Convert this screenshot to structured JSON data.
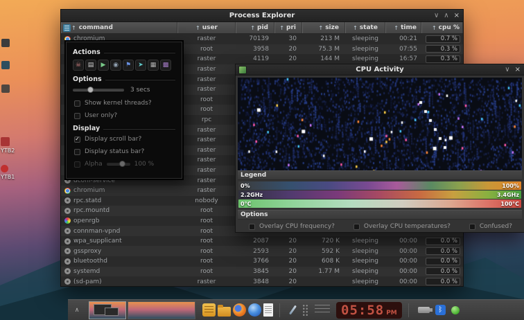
{
  "desktop": {
    "icons": [
      {
        "name": "shortcut-icon",
        "label": "YTB2"
      },
      {
        "name": "shortcut-icon",
        "label": "YTB1"
      }
    ]
  },
  "process_explorer": {
    "title": "Process Explorer",
    "window_controls": [
      "collapse-icon",
      "maximize-icon",
      "close-icon"
    ],
    "columns": [
      "command",
      "user",
      "pid",
      "pri",
      "size",
      "state",
      "time",
      "cpu %"
    ],
    "rows": [
      {
        "icon": "chromium",
        "cmd": "chromium",
        "user": "raster",
        "pid": "70139",
        "pri": "30",
        "size": "213 M",
        "state": "sleeping",
        "time": "00:21",
        "cpu": "0.7 %"
      },
      {
        "user": "root",
        "pid": "3958",
        "pri": "20",
        "size": "75.3 M",
        "state": "sleeping",
        "time": "07:55",
        "cpu": "0.3 %"
      },
      {
        "user": "raster",
        "pid": "4119",
        "pri": "20",
        "size": "144 M",
        "state": "sleeping",
        "time": "16:57",
        "cpu": "0.3 %"
      },
      {
        "user": "raster"
      },
      {
        "user": "raster"
      },
      {
        "user": "raster"
      },
      {
        "user": "root"
      },
      {
        "user": "root"
      },
      {
        "user": "rpc"
      },
      {
        "user": "raster"
      },
      {
        "user": "raster"
      },
      {
        "user": "raster"
      },
      {
        "user": "raster"
      },
      {
        "user": "raster"
      },
      {
        "icon": "gear",
        "cmd": "dconf-service",
        "user": "raster"
      },
      {
        "icon": "chromium",
        "cmd": "chromium",
        "user": "raster"
      },
      {
        "icon": "gear",
        "cmd": "rpc.statd",
        "user": "nobody"
      },
      {
        "icon": "gear",
        "cmd": "rpc.mountd",
        "user": "root"
      },
      {
        "icon": "rgb",
        "cmd": "openrgb",
        "user": "root"
      },
      {
        "icon": "gear",
        "cmd": "connman-vpnd",
        "user": "root"
      },
      {
        "icon": "gear",
        "cmd": "wpa_supplicant",
        "user": "root",
        "pid": "2087",
        "pri": "20",
        "size": "720 K",
        "state": "sleeping",
        "time": "00:00",
        "cpu": "0.0 %"
      },
      {
        "icon": "gear",
        "cmd": "gssproxy",
        "user": "root",
        "pid": "2593",
        "pri": "20",
        "size": "592 K",
        "state": "sleeping",
        "time": "00:00",
        "cpu": "0.0 %"
      },
      {
        "icon": "gear",
        "cmd": "bluetoothd",
        "user": "root",
        "pid": "3766",
        "pri": "20",
        "size": "608 K",
        "state": "sleeping",
        "time": "00:00",
        "cpu": "0.0 %"
      },
      {
        "icon": "gear",
        "cmd": "systemd",
        "user": "root",
        "pid": "3845",
        "pri": "20",
        "size": "1.77 M",
        "state": "sleeping",
        "time": "00:00",
        "cpu": "0.0 %"
      },
      {
        "icon": "gear",
        "cmd": "(sd-pam)",
        "user": "raster",
        "pid": "3848",
        "pri": "20",
        "size": "",
        "state": "sleeping",
        "time": "00:00",
        "cpu": "0.0 %"
      }
    ]
  },
  "actions_panel": {
    "title": "Actions",
    "tools": [
      "kill-icon",
      "processes-icon",
      "run-icon",
      "inspect-icon",
      "priority-icon",
      "export-icon",
      "gauge-icon",
      "theme-icon"
    ],
    "options_title": "Options",
    "poll_interval_label": "3 secs",
    "option_checkboxes": [
      {
        "label": "Show kernel threads?",
        "checked": false
      },
      {
        "label": "User only?",
        "checked": false
      }
    ],
    "display_title": "Display",
    "display_checkboxes": [
      {
        "label": "Display scroll bar?",
        "checked": true
      },
      {
        "label": "Display status bar?",
        "checked": false
      }
    ],
    "alpha_label": "Alpha",
    "alpha_value": "100 %"
  },
  "cpu_activity": {
    "title": "CPU Activity",
    "window_controls": [
      "collapse-icon",
      "close-icon"
    ],
    "legend_title": "Legend",
    "legend_bars": [
      {
        "left": "0%",
        "right": "100%"
      },
      {
        "left": "2.2GHz",
        "right": "3.4GHz"
      },
      {
        "left": "0°C",
        "right": "100°C"
      }
    ],
    "options_title": "Options",
    "option_checkboxes": [
      {
        "label": "Overlay CPU frequency?",
        "checked": false
      },
      {
        "label": "Overlay CPU temperatures?",
        "checked": false
      },
      {
        "label": "Confused?",
        "checked": false
      }
    ]
  },
  "taskbar": {
    "autohide_icon": "shelf-arrow-icon",
    "launcher_icons": [
      "notes-icon",
      "folder-icon",
      "firefox-icon",
      "globe-icon",
      "document-icon"
    ],
    "tool_icons": [
      "picker-icon",
      "handle-icon"
    ],
    "clock": {
      "time": "05:58",
      "meridiem": "PM"
    },
    "tray_icons": [
      "usb-icon",
      "bluetooth-icon",
      "status-icon"
    ]
  }
}
